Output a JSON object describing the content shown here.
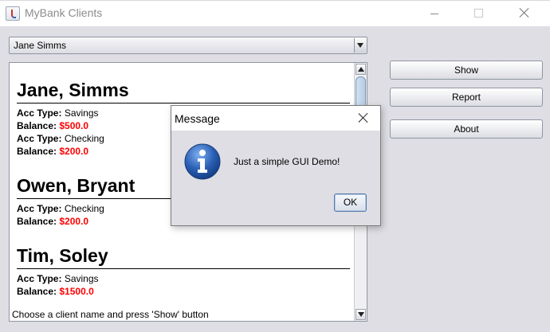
{
  "window": {
    "title": "MyBank Clients"
  },
  "combo": {
    "selected": "Jane Simms"
  },
  "clients": [
    {
      "name": "Jane, Simms",
      "accounts": [
        {
          "type_label": "Acc Type:",
          "type": "Savings",
          "balance_label": "Balance:",
          "balance": "$500.0"
        },
        {
          "type_label": "Acc Type:",
          "type": "Checking",
          "balance_label": "Balance:",
          "balance": "$200.0"
        }
      ]
    },
    {
      "name": "Owen, Bryant",
      "accounts": [
        {
          "type_label": "Acc Type:",
          "type": "Checking",
          "balance_label": "Balance:",
          "balance": "$200.0"
        }
      ]
    },
    {
      "name": "Tim, Soley",
      "accounts": [
        {
          "type_label": "Acc Type:",
          "type": "Savings",
          "balance_label": "Balance:",
          "balance": "$1500.0"
        }
      ]
    }
  ],
  "buttons": {
    "show": "Show",
    "report": "Report",
    "about": "About"
  },
  "status": "Choose a client name and press 'Show' button",
  "dialog": {
    "title": "Message",
    "message": "Just a simple GUI Demo!",
    "ok": "OK",
    "icon": "info-icon"
  },
  "colors": {
    "balance": "#ff0000",
    "background": "#dedee4",
    "info_icon": "#2a5fb5"
  }
}
